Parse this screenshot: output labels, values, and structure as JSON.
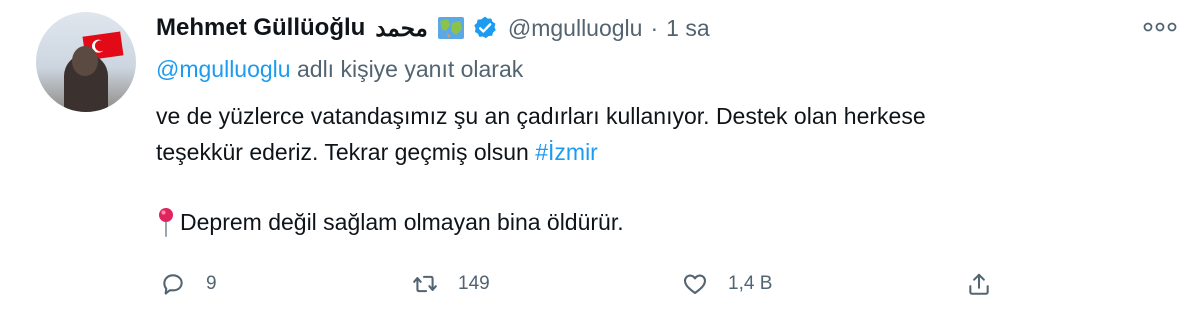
{
  "tweet": {
    "author_name": "Mehmet Güllüoğlu",
    "author_arabic": "محمد",
    "handle": "@mgulluoglu",
    "separator": "·",
    "time": "1 sa",
    "reply_mention": "@mgulluoglu",
    "reply_suffix": "adlı kişiye yanıt olarak",
    "body_line1": "ve de yüzlerce vatandaşımız şu an çadırları kullanıyor. Destek olan herkese",
    "body_line2_prefix": "teşekkür ederiz. Tekrar geçmiş olsun",
    "hashtag": "#İzmir",
    "pin_text": "Deprem değil sağlam olmayan bina öldürür."
  },
  "actions": {
    "reply_count": "9",
    "retweet_count": "149",
    "like_count": "1,4 B"
  },
  "icons": {
    "header": [
      "avatar",
      "map-icon",
      "verified-icon",
      "more-icon"
    ],
    "body": [
      "pin-icon"
    ],
    "actions": [
      "reply-icon",
      "retweet-icon",
      "like-icon",
      "share-icon"
    ]
  },
  "colors": {
    "accent": "#1d9bf0",
    "text": "#0f1419",
    "secondary": "#536471",
    "pin": "#e0245e"
  }
}
